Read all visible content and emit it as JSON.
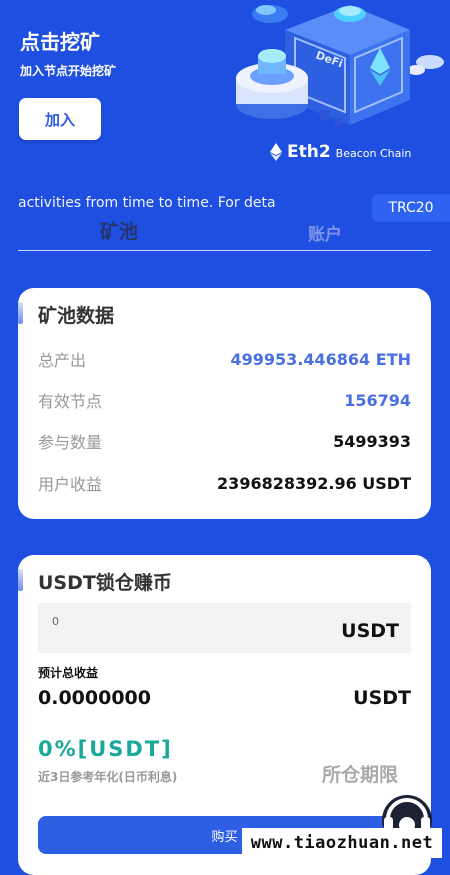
{
  "hero": {
    "title": "点击挖矿",
    "subtitle": "加入节点开始挖矿",
    "join_label": "加入",
    "brand_big": "Eth2",
    "brand_small": "Beacon Chain",
    "defi_text": "DeFi"
  },
  "marquee": {
    "text": "activities from time to time. For deta"
  },
  "network_tag": "TRC20",
  "tabs": [
    {
      "label": "矿池",
      "active": true
    },
    {
      "label": "账户",
      "active": false
    }
  ],
  "pool_data": {
    "title": "矿池数据",
    "rows": [
      {
        "label": "总产出",
        "value": "499953.446864 ETH",
        "highlight": true
      },
      {
        "label": "有效节点",
        "value": "156794",
        "highlight": true
      },
      {
        "label": "参与数量",
        "value": "5499393",
        "highlight": false
      },
      {
        "label": "用户收益",
        "value": "2396828392.96 USDT",
        "highlight": false
      }
    ]
  },
  "lock": {
    "title": "USDT锁仓赚币",
    "amount_value": "0",
    "amount_unit": "USDT",
    "estimate_label": "预计总收益",
    "estimate_value": "0.0000000",
    "estimate_unit": "USDT",
    "rate": "0%[USDT]",
    "rate_note": "近3日参考年化(日币利息)",
    "period_label": "所仓期限",
    "buy_label": "购买"
  },
  "watermark": "www.tiaozhuan.net",
  "colors": {
    "background": "#1e4fe0",
    "accent_blue": "#4a6fe0",
    "teal": "#1aa89a",
    "button": "#2d5ee4"
  }
}
